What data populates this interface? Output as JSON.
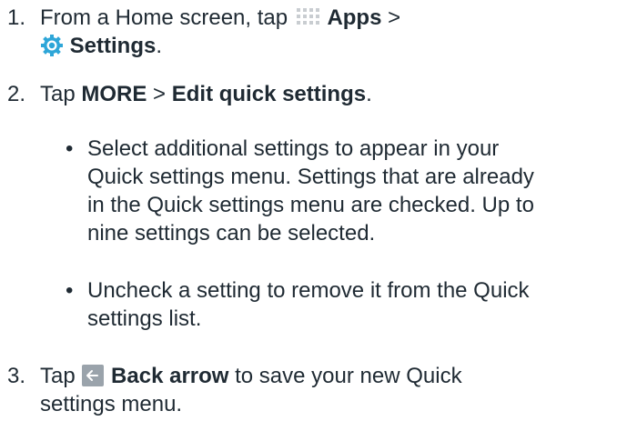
{
  "steps": [
    {
      "number": "1.",
      "line1_pre": "From a Home screen, tap ",
      "apps_icon": "apps-grid-icon",
      "apps_label": "Apps",
      "line1_post": " >",
      "settings_icon": "settings-gear-icon",
      "settings_label": "Settings",
      "line2_post": "."
    },
    {
      "number": "2.",
      "pre": "Tap ",
      "more_label": "MORE",
      "sep": " > ",
      "edit_label": "Edit quick settings",
      "post": "."
    },
    {
      "number": "3.",
      "pre": "Tap ",
      "back_icon": "back-arrow-icon",
      "back_label": "Back arrow",
      "line1_post": " to save your new Quick",
      "line2": "settings menu."
    }
  ],
  "bullets": [
    {
      "lines": [
        "Select additional settings to appear in your",
        "Quick settings menu. Settings that are already",
        "in the Quick settings menu are checked. Up to",
        "nine settings can be selected."
      ]
    },
    {
      "lines": [
        "Uncheck a setting to remove it from the Quick",
        "settings list."
      ]
    }
  ],
  "colors": {
    "text": "#1f2a33",
    "apps_icon_dots": "#c9cdd1",
    "settings_icon": "#2ea6d8",
    "back_icon_bg": "#9aa3ab"
  }
}
